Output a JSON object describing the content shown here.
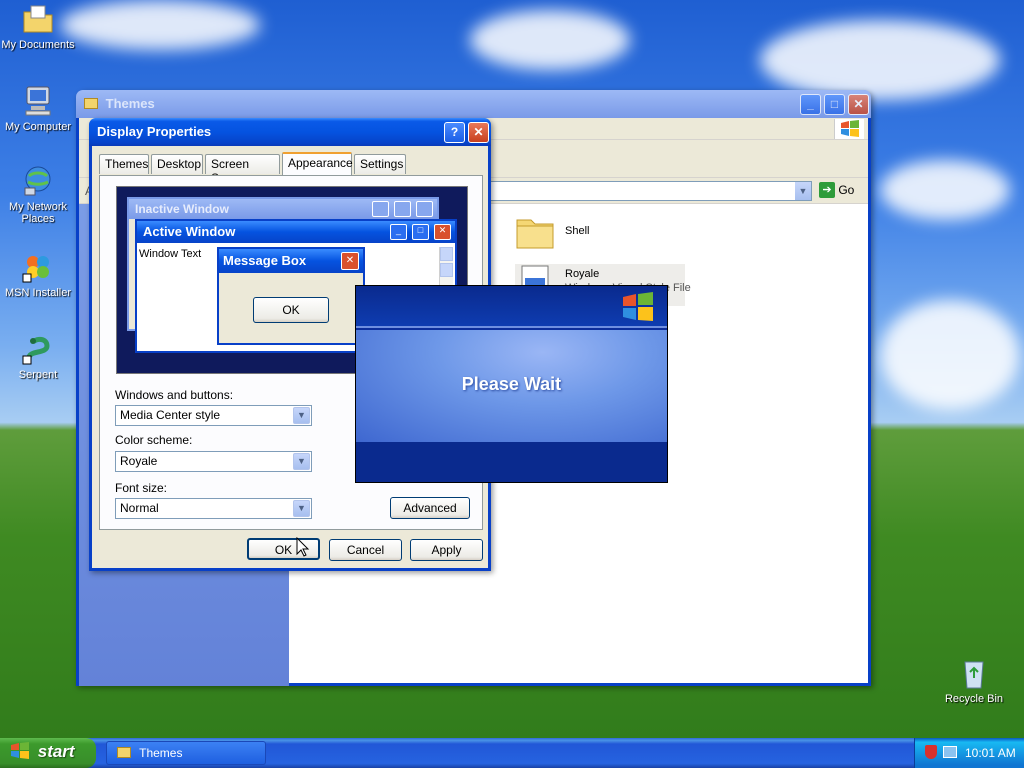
{
  "desktop": {
    "icons": [
      {
        "label": "My Documents",
        "icon": "folder-documents-icon"
      },
      {
        "label": "My Computer",
        "icon": "computer-icon"
      },
      {
        "label": "My Network Places",
        "icon": "network-icon"
      },
      {
        "label": "MSN Installer",
        "icon": "msn-butterfly-icon"
      },
      {
        "label": "Serpent",
        "icon": "serpent-icon"
      },
      {
        "label": "Recycle Bin",
        "icon": "recycle-bin-icon"
      }
    ]
  },
  "themes_window": {
    "title": "Themes",
    "address_go": "Go",
    "address_letter": "A",
    "files": [
      {
        "name": "Shell",
        "type": ""
      },
      {
        "name": "Royale",
        "type": "Windows Visual Style File"
      }
    ]
  },
  "display_properties": {
    "title": "Display Properties",
    "tabs": [
      "Themes",
      "Desktop",
      "Screen Saver",
      "Appearance",
      "Settings"
    ],
    "active_tab": "Appearance",
    "preview": {
      "inactive_title": "Inactive Window",
      "active_title": "Active Window",
      "window_text": "Window Text",
      "message_title": "Message Box",
      "message_ok": "OK"
    },
    "windows_buttons_label": "Windows and buttons:",
    "windows_buttons_value": "Media Center style",
    "color_scheme_label": "Color scheme:",
    "color_scheme_value": "Royale",
    "font_size_label": "Font size:",
    "font_size_value": "Normal",
    "advanced_label": "Advanced",
    "ok_label": "OK",
    "cancel_label": "Cancel",
    "apply_label": "Apply"
  },
  "please_wait": {
    "text": "Please Wait"
  },
  "taskbar": {
    "start_label": "start",
    "task_label": "Themes",
    "clock": "10:01 AM"
  },
  "colors": {
    "xp_blue": "#0553e0",
    "wait_dark": "#0c2d9a",
    "wait_mid": "#6e98e8"
  }
}
